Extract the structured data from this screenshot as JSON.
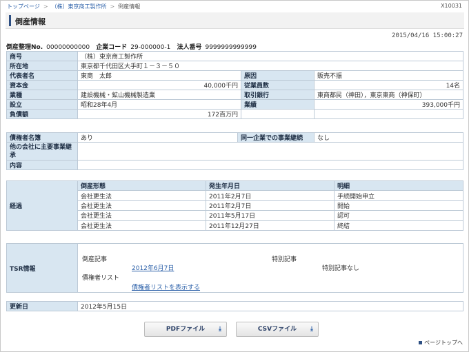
{
  "breadcrumb": {
    "home": "トップページ",
    "company": "（株）東京商工製作所",
    "current": "倒産情報",
    "sep": ">"
  },
  "page_id": "X10031",
  "title": "倒産情報",
  "timestamp": "2015/04/16 15:00:27",
  "registration": {
    "no_label": "倒産整理No.",
    "no_value": "00000000000",
    "code_label": "企業コード",
    "code_value": "29-000000-1",
    "corp_label": "法人番号",
    "corp_value": "9999999999999"
  },
  "company": {
    "trade_name_label": "商号",
    "trade_name": "（株）東京商工製作所",
    "address_label": "所在地",
    "address": "東京都千代田区大手町１－３－５０",
    "rep_label": "代表者名",
    "rep": "東商　太郎",
    "cause_label": "原因",
    "cause": "販売不振",
    "capital_label": "資本金",
    "capital": "40,000千円",
    "employees_label": "従業員数",
    "employees": "14名",
    "industry_label": "業種",
    "industry": "建設機械・鉱山機械製造業",
    "bank_label": "取引銀行",
    "bank": "東商都民（神田），東京東商（神保町）",
    "founded_label": "設立",
    "founded": "昭和28年4月",
    "sales_label": "業績",
    "sales": "393,000千円",
    "debt_label": "負債額",
    "debt": "172百万円"
  },
  "creditors": {
    "names_label": "債権者名簿",
    "names": "あり",
    "same_label": "同一企業での事業継続",
    "same": "なし",
    "other_label": "他の会社に主要事業継承",
    "other": "",
    "content_label": "内容",
    "content": ""
  },
  "history": {
    "label": "経過",
    "headers": [
      "倒産形態",
      "発生年月日",
      "明細"
    ],
    "rows": [
      [
        "会社更生法",
        "2011年2月7日",
        "手続開始申立"
      ],
      [
        "会社更生法",
        "2011年2月7日",
        "開始"
      ],
      [
        "会社更生法",
        "2011年5月17日",
        "認可"
      ],
      [
        "会社更生法",
        "2011年12月27日",
        "終結"
      ]
    ]
  },
  "tsr": {
    "label": "TSR情報",
    "article_label": "倒産記事",
    "article_link": "2012年6月7日",
    "special_label": "特別記事",
    "special_value": "特別記事なし",
    "creditor_list_label": "債権者リスト",
    "creditor_list_link": "債権者リストを表示する"
  },
  "update": {
    "label": "更新日",
    "value": "2012年5月15日"
  },
  "buttons": {
    "pdf": "PDFファイル",
    "csv": "CSVファイル"
  },
  "page_top": "ページトップへ",
  "colors": {
    "header_bg": "#d8e6f1",
    "link": "#2a5fa8",
    "accent": "#2d4f83"
  }
}
